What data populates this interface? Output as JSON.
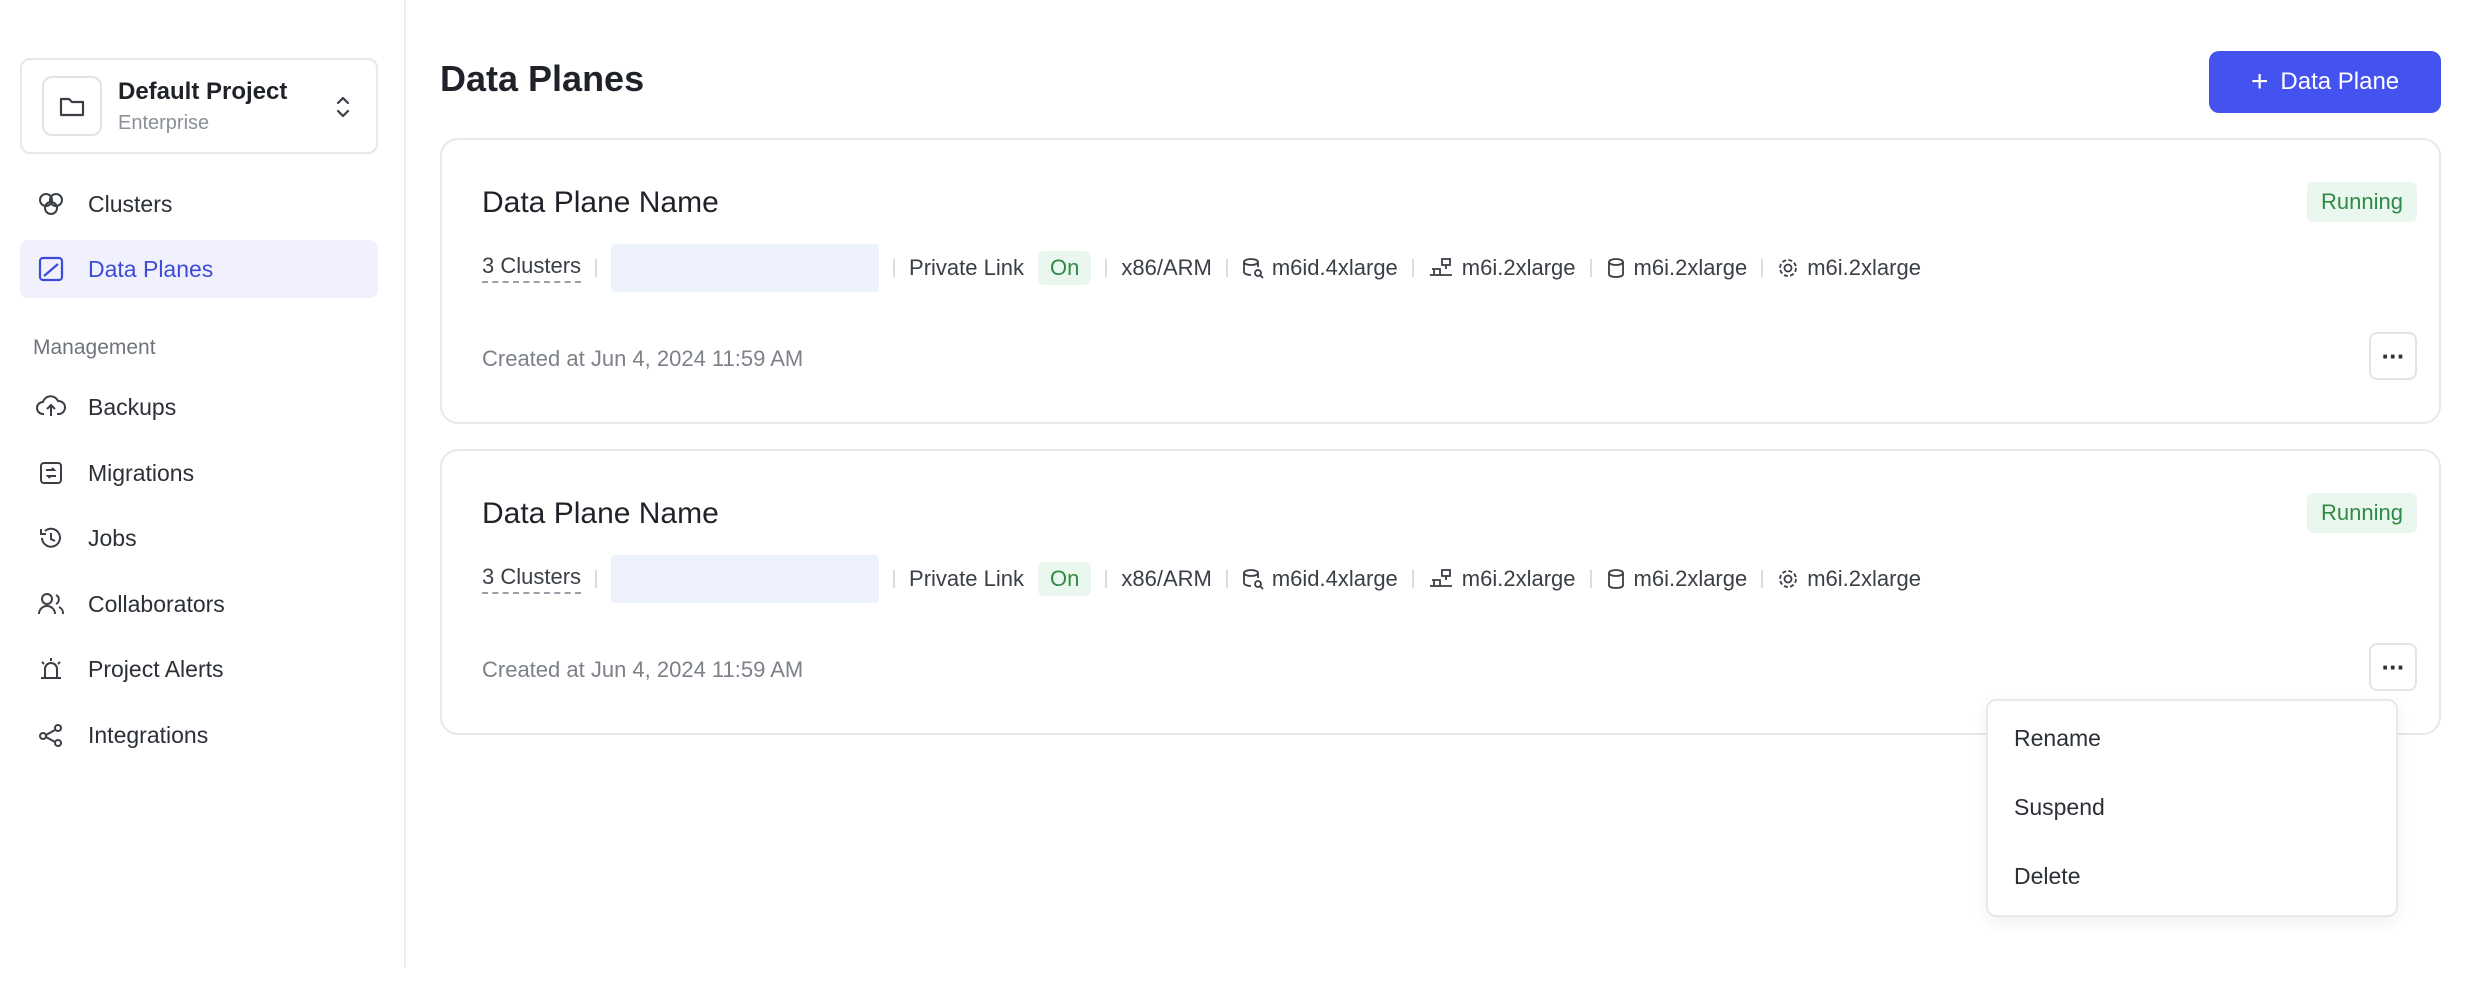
{
  "sidebar": {
    "project": {
      "name": "Default Project",
      "tier": "Enterprise"
    },
    "nav": [
      {
        "label": "Clusters",
        "icon": "clusters-icon",
        "active": false
      },
      {
        "label": "Data Planes",
        "icon": "data-planes-icon",
        "active": true
      }
    ],
    "management_label": "Management",
    "management": [
      {
        "label": "Backups",
        "icon": "cloud-upload-icon"
      },
      {
        "label": "Migrations",
        "icon": "migrations-icon"
      },
      {
        "label": "Jobs",
        "icon": "history-icon"
      },
      {
        "label": "Collaborators",
        "icon": "users-icon"
      },
      {
        "label": "Project Alerts",
        "icon": "alarm-icon"
      },
      {
        "label": "Integrations",
        "icon": "share-icon"
      }
    ]
  },
  "main": {
    "title": "Data Planes",
    "add_button": {
      "plus": "+",
      "label": "Data Plane"
    },
    "cards": [
      {
        "name": "Data Plane Name",
        "status": "Running",
        "clusters": "3 Clusters",
        "private_link_label": "Private Link",
        "private_link_value": "On",
        "arch": "x86/ARM",
        "spec1": "m6id.4xlarge",
        "spec2": "m6i.2xlarge",
        "spec3": "m6i.2xlarge",
        "spec4": "m6i.2xlarge",
        "created": "Created at Jun 4, 2024 11:59 AM",
        "more": "···"
      },
      {
        "name": "Data Plane Name",
        "status": "Running",
        "clusters": "3 Clusters",
        "private_link_label": "Private Link",
        "private_link_value": "On",
        "arch": "x86/ARM",
        "spec1": "m6id.4xlarge",
        "spec2": "m6i.2xlarge",
        "spec3": "m6i.2xlarge",
        "spec4": "m6i.2xlarge",
        "created": "Created at Jun 4, 2024 11:59 AM",
        "more": "···"
      }
    ],
    "context_menu": {
      "items": [
        "Rename",
        "Suspend",
        "Delete"
      ]
    }
  },
  "colors": {
    "accent": "#4453f0",
    "active_bg": "#f0f1fc",
    "running_bg": "#eaf7ee",
    "running_text": "#2f8a45"
  }
}
